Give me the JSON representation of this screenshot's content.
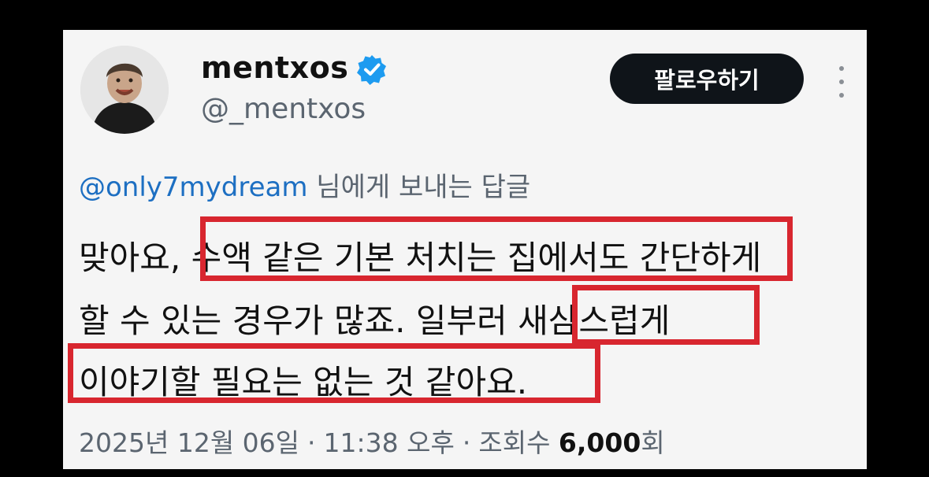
{
  "profile": {
    "display_name": "mentxos",
    "handle": "@_mentxos",
    "verified": true,
    "verified_color": "#1d9bf0"
  },
  "actions": {
    "follow_label": "팔로우하기",
    "more_icon": "more-vertical-icon"
  },
  "reply": {
    "mention": "@only7mydream",
    "suffix": " 님에게 보내는 답글"
  },
  "tweet": {
    "line1_a": "맞아요, ",
    "line1_b": "수액 같은 기본 처치는 집에서도 간단",
    "line1_c": "하게",
    "line2_a": "할 수 있는 경우가 많죠. 일부러 ",
    "line2_b": "새삼스럽게",
    "line3": "이야기할 필요는 없는 것 같아요.",
    "highlight_color": "#d8262f"
  },
  "meta": {
    "date": "2025년 12월 06일",
    "time": "11:38 오후",
    "views_label": "조회수 ",
    "views_count": "6,000",
    "views_unit": "회",
    "separator": "·"
  }
}
